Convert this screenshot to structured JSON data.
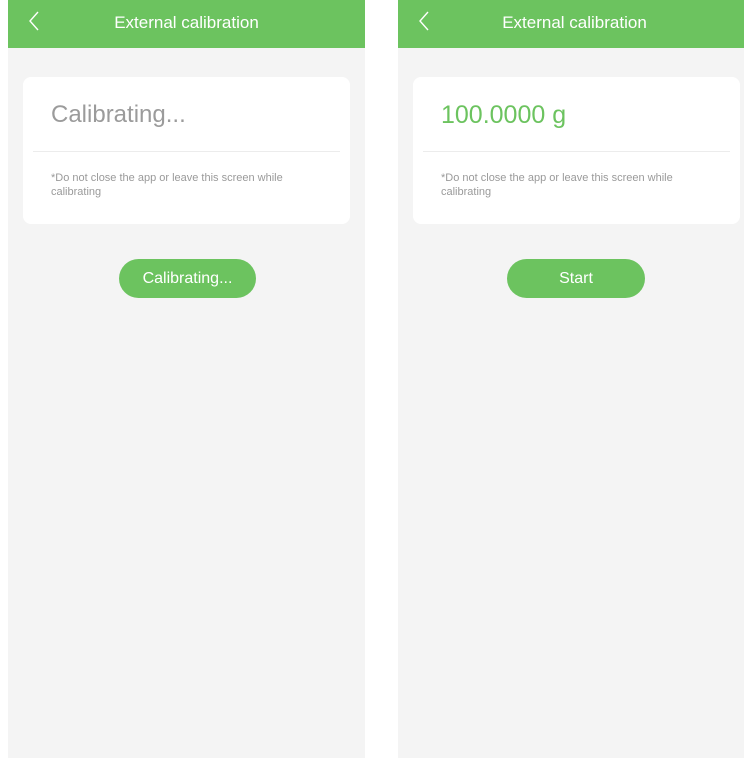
{
  "screens": [
    {
      "header": {
        "title": "External calibration",
        "back_icon": "chevron-left-icon"
      },
      "card": {
        "value": "Calibrating...",
        "note": "*Do not close the app or leave this screen while calibrating"
      },
      "button": {
        "label": "Calibrating..."
      }
    },
    {
      "header": {
        "title": "External calibration",
        "back_icon": "chevron-left-icon"
      },
      "card": {
        "value": "100.0000 g",
        "note": "*Do not close the app or leave this screen while calibrating"
      },
      "button": {
        "label": "Start"
      }
    }
  ],
  "colors": {
    "accent": "#6cc35f",
    "background": "#f4f4f4",
    "card": "#ffffff",
    "muted_text": "#9b9b9b"
  }
}
